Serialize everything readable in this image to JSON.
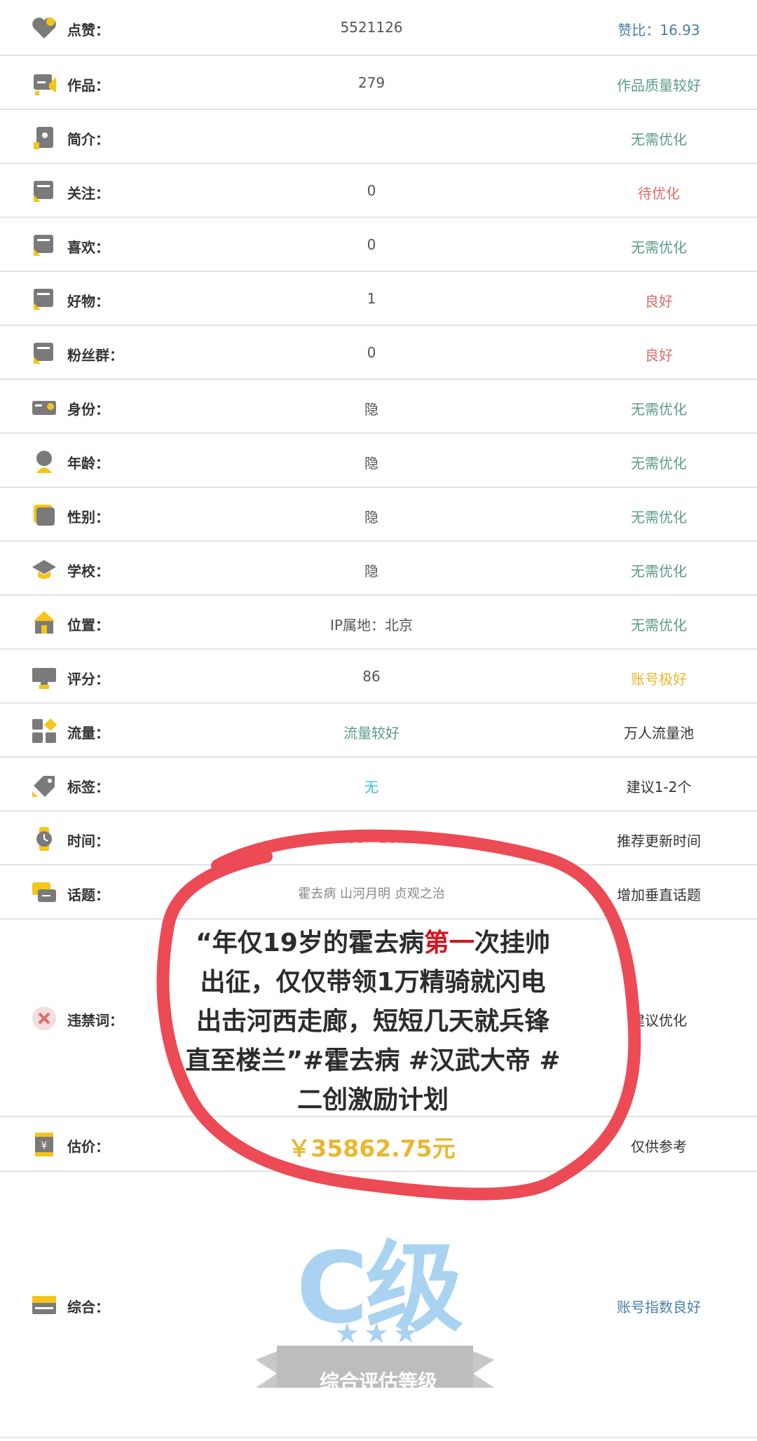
{
  "rows": [
    {
      "icon": "heart-icon",
      "label": "点赞：",
      "value": "5521126",
      "status": "赞比：16.93",
      "status_color": "blue"
    },
    {
      "icon": "works-icon",
      "label": "作品：",
      "value": "279",
      "status": "作品质量较好",
      "status_color": "green"
    },
    {
      "icon": "profile-icon",
      "label": "简介：",
      "value": "",
      "status": "无需优化",
      "status_color": "green"
    },
    {
      "icon": "follow-icon",
      "label": "关注：",
      "value": "0",
      "status": "待优化",
      "status_color": "red"
    },
    {
      "icon": "like-icon",
      "label": "喜欢：",
      "value": "0",
      "status": "无需优化",
      "status_color": "green"
    },
    {
      "icon": "goods-icon",
      "label": "好物：",
      "value": "1",
      "status": "良好",
      "status_color": "red"
    },
    {
      "icon": "fans-group-icon",
      "label": "粉丝群：",
      "value": "0",
      "status": "良好",
      "status_color": "red"
    },
    {
      "icon": "id-card-icon",
      "label": "身份：",
      "value": "隐",
      "status": "无需优化",
      "status_color": "green"
    },
    {
      "icon": "age-icon",
      "label": "年龄：",
      "value": "隐",
      "status": "无需优化",
      "status_color": "green"
    },
    {
      "icon": "gender-icon",
      "label": "性别：",
      "value": "隐",
      "status": "无需优化",
      "status_color": "green"
    },
    {
      "icon": "school-icon",
      "label": "学校：",
      "value": "隐",
      "status": "无需优化",
      "status_color": "green"
    },
    {
      "icon": "location-icon",
      "label": "位置：",
      "value": "IP属地：北京",
      "status": "无需优化",
      "status_color": "green"
    },
    {
      "icon": "score-icon",
      "label": "评分：",
      "value": "86",
      "status": "账号极好",
      "status_color": "yellow"
    },
    {
      "icon": "traffic-icon",
      "label": "流量：",
      "value": "流量较好",
      "value_color": "green",
      "status": "万人流量池",
      "status_color": "dark"
    },
    {
      "icon": "tag-icon",
      "label": "标签：",
      "value": "无",
      "value_color": "cyan",
      "status": "建议1-2个",
      "status_color": "dark"
    },
    {
      "icon": "clock-icon",
      "label": "时间：",
      "value": "14:00 - 16:00",
      "value_color": "pink",
      "status": "推荐更新时间",
      "status_color": "dark"
    },
    {
      "icon": "topic-icon",
      "label": "话题：",
      "value": "霍去病 山河月明 贞观之治",
      "status": "增加垂直话题",
      "status_color": "dark"
    },
    {
      "icon": "banned-words-icon",
      "label": "违禁词：",
      "value": "",
      "status": "建议优化",
      "status_color": "dark"
    },
    {
      "icon": "price-icon",
      "label": "估价：",
      "value": "",
      "status": "仅供参考",
      "status_color": "dark"
    },
    {
      "icon": "summary-icon",
      "label": "综合：",
      "value": "",
      "status": "账号指数良好",
      "status_color": "blue"
    }
  ],
  "overlay": {
    "line1_pre": "“年仅19岁的霍去病",
    "line1_hl": "第一",
    "line1_post": "次挂帅",
    "line2": "出征，仅仅带领1万精骑就闪电",
    "line3": "出击河西走廊，短短几天就兵锋",
    "line4": "直至楼兰”#霍去病 #汉武大帝 #",
    "line5": "二创激励计划",
    "price": "￥35862.75元"
  },
  "badge": {
    "grade": "C级",
    "stars": "★★★",
    "caption": "综合评估等级"
  },
  "colors": {
    "green": "#5c9a8a",
    "red": "#e06a6a",
    "yellow": "#eab72e",
    "blue": "#4b7fa6",
    "circle": "#ec4a55",
    "badge_blue": "#a9d3f1",
    "ribbon": "#c8c8c8"
  }
}
